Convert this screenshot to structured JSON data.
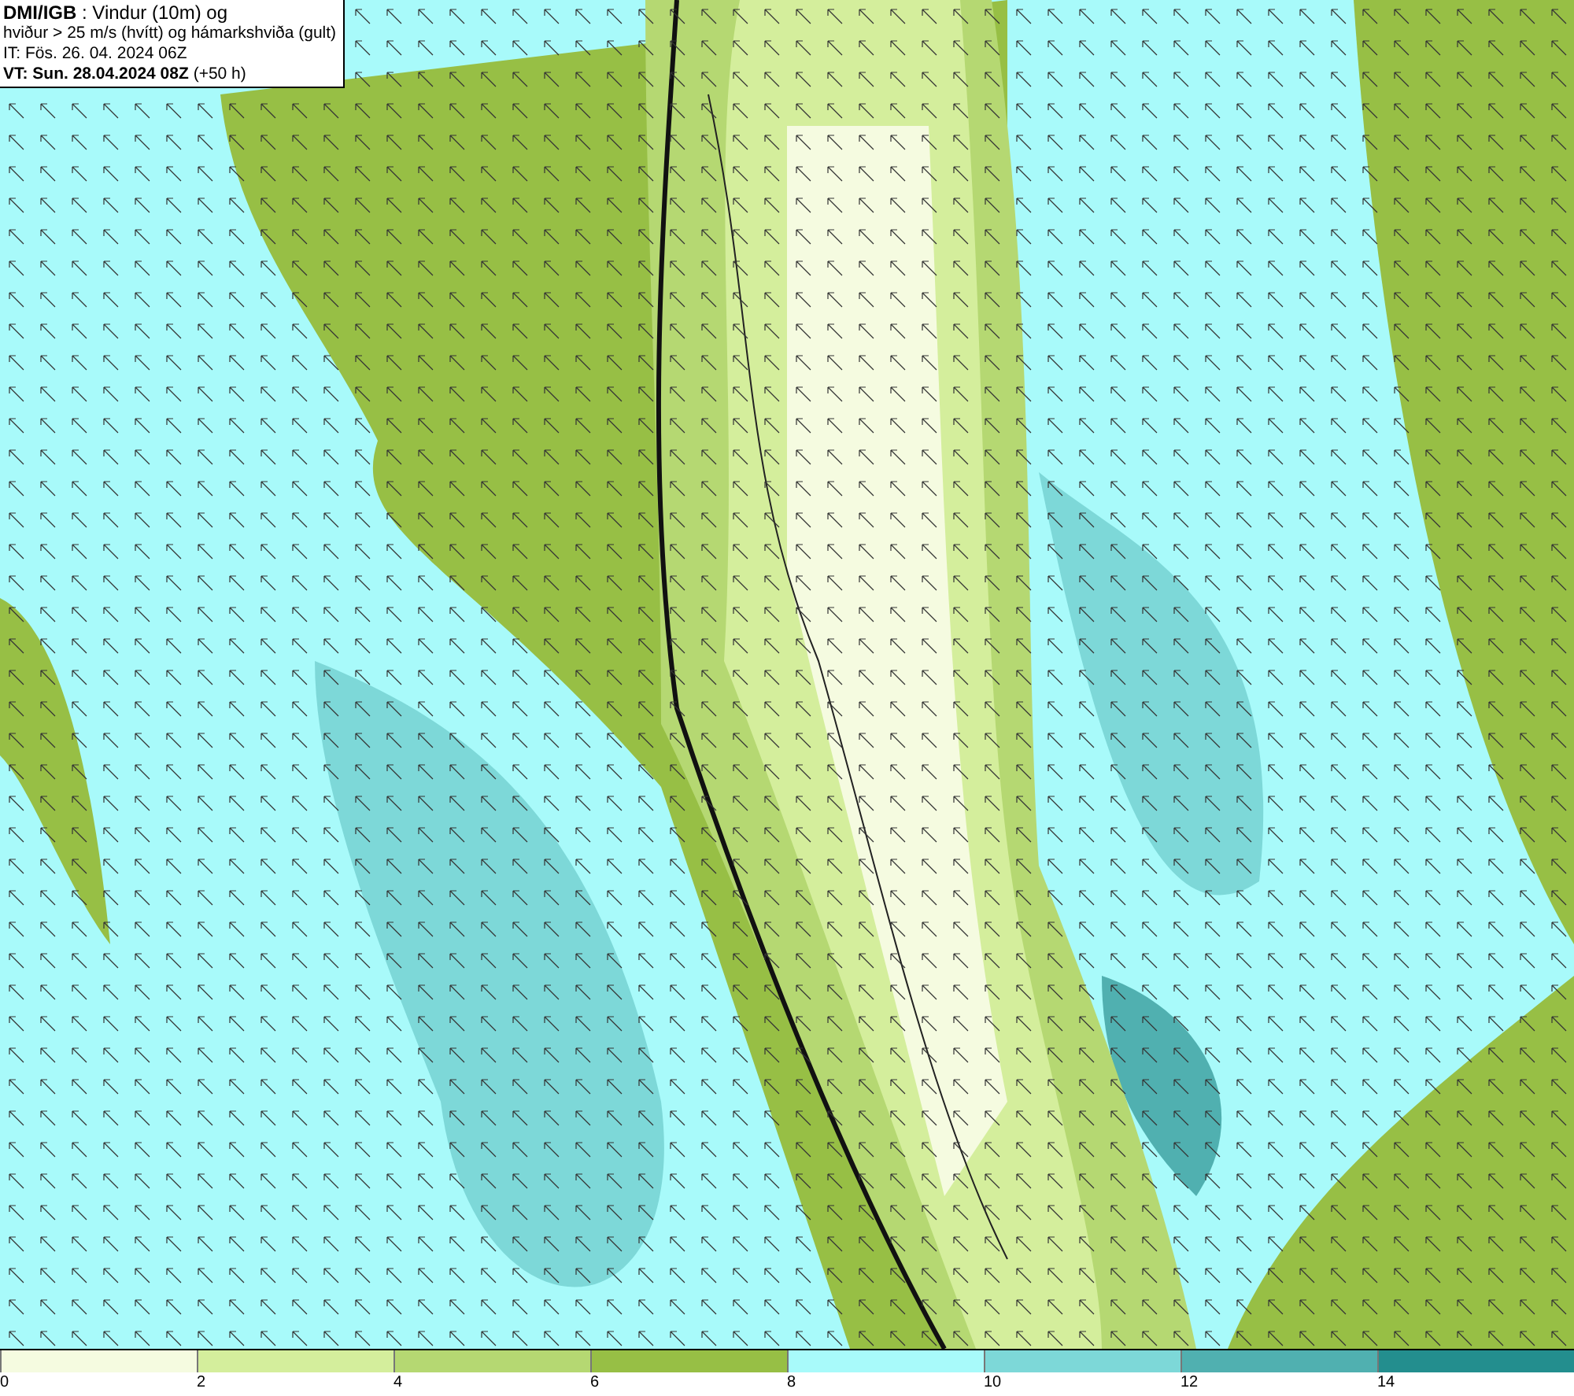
{
  "header": {
    "lines": [
      "**DMI/IGB** : Vindur (10m) og",
      "hviður > 25 m/s (hvítt) og hámarkshviða (gult)",
      "IT: Fös. 26. 04. 2024 06Z",
      "**VT: Sun. 28.04.2024 08Z** (+50 h)"
    ]
  },
  "legend": [
    {
      "label": "0",
      "color": "#f5fbe0"
    },
    {
      "label": "2",
      "color": "#d4ee9c"
    },
    {
      "label": "4",
      "color": "#b5d872"
    },
    {
      "label": "6",
      "color": "#97bf45"
    },
    {
      "label": "8",
      "color": "#a8fafa"
    },
    {
      "label": "10",
      "color": "#7dd8d8"
    },
    {
      "label": "12",
      "color": "#50b0b0"
    },
    {
      "label": "14",
      "color": "#238e8e"
    }
  ]
}
